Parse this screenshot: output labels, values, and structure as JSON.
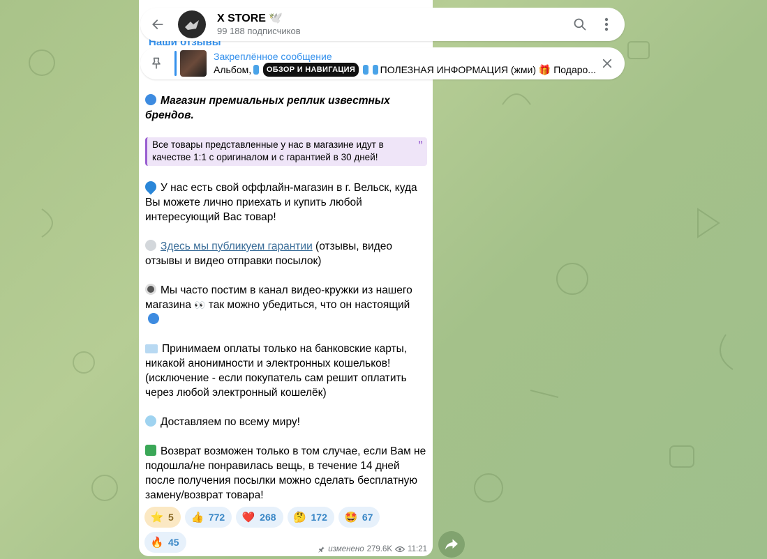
{
  "header": {
    "channel_name": "X STORE 🕊️",
    "subscribers": "99 188 подписчиков"
  },
  "pinned": {
    "title": "Закреплённое сообщение",
    "preview_prefix": "Альбом,",
    "badge": "ОБЗОР И НАВИГАЦИЯ",
    "preview_suffix": "ПОЛЕЗНАЯ ИНФОРМАЦИЯ (жми) 🎁 Подаро..."
  },
  "message": {
    "prev_link": "Наши отзывы",
    "headline": "Магазин премиальных реплик известных брендов.",
    "quote": "Все товары представленные у нас в магазине идут в качестве 1:1 с оригиналом и с гарантией в 30 дней!",
    "quote_mark": "”",
    "offline": "У нас есть свой оффлайн-магазин в г. Вельск, куда Вы можете лично приехать и купить любой интересующий Вас товар!",
    "guarantee_link": "Здесь мы публикуем гарантии",
    "guarantee_rest": "(отзывы, видео отзывы и видео отправки посылок)",
    "video_text_1": "Мы часто постим в канал видео-кружки из нашего магазина",
    "video_eyes": "👀",
    "video_text_2": "так можно убедиться, что он настоящий",
    "payment": "Принимаем оплаты только на банковские карты, никакой анонимности и электронных кошельков! (исключение - если покупатель сам решит оплатить через любой электронный кошелёк)",
    "delivery": "Доставляем по всему миру!",
    "returns": "Возврат возможен только в том случае, если Вам не подошла/не понравилась вещь, в течение 14 дней после получения посылки можно сделать бесплатную замену/возврат товара!"
  },
  "reactions": [
    {
      "emoji": "⭐",
      "count": "5"
    },
    {
      "emoji": "👍",
      "count": "772"
    },
    {
      "emoji": "❤️",
      "count": "268"
    },
    {
      "emoji": "🤔",
      "count": "172"
    },
    {
      "emoji": "🤩",
      "count": "67"
    },
    {
      "emoji": "🔥",
      "count": "45"
    }
  ],
  "meta": {
    "edited": "изменено",
    "views": "279.6K",
    "time": "11:21"
  },
  "colors": {
    "accent": "#3390ec",
    "quote_border": "#9a5fd1",
    "bubble": "#ffffff"
  }
}
